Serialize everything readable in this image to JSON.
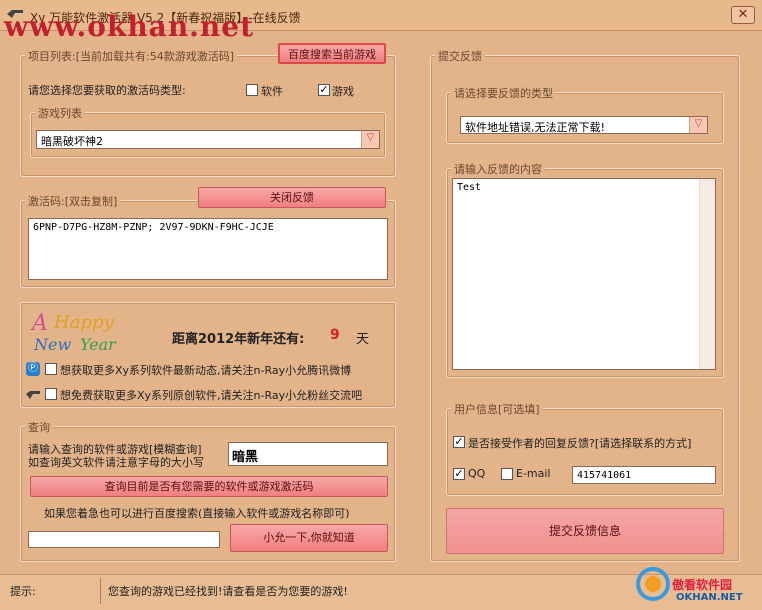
{
  "window": {
    "title": "Xy 万能软件激活器 V5.2【新春祝福版】-在线反馈",
    "watermark": "www.okhan.net",
    "close_label": "✕"
  },
  "project_list": {
    "legend": "项目列表:[当前加载共有:54款游戏激活码]",
    "baidu_search_button": "百度搜索当前游戏",
    "type_prompt": "请您选择您要获取的激活码类型:",
    "software_label": "软件",
    "software_checked": false,
    "game_label": "游戏",
    "game_checked": true,
    "game_list_legend": "游戏列表",
    "selected_game": "暗黑破坏神2"
  },
  "activation": {
    "legend": "激活码:[双击复制]",
    "close_feedback_button": "关闭反馈",
    "code_text": "6PNP-D7PG-HZ8M-PZNP; 2V97-9DKN-F9HC-JCJE"
  },
  "promo": {
    "logo_text": "AHappy New Year",
    "countdown_label": "距离2012年新年还有:",
    "countdown_days": "9",
    "countdown_unit": "天",
    "row1_text": "想获取更多Xy系列软件最新动态,请关注n-Ray小允腾讯微博",
    "row2_text": "想免费获取更多Xy系列原创软件,请关注n-Ray小允粉丝交流吧"
  },
  "query": {
    "legend": "查询",
    "prompt_line1": "请输入查询的软件或游戏[模糊查询]",
    "prompt_line2": "如查询英文软件请注意字母的大小写",
    "query_value": "暗黑",
    "check_button": "查询目前是否有您需要的软件或游戏激活码",
    "baidu_hint": "如果您着急也可以进行百度搜索(直接输入软件或游戏名称即可)",
    "baidu_input_value": "",
    "baidu_button": "小允一下,你就知道"
  },
  "feedback": {
    "legend": "提交反馈",
    "type_legend": "请选择要反馈的类型",
    "selected_type": "软件地址错误,无法正常下载!",
    "content_legend": "请输入反馈的内容",
    "content_value": "Test",
    "user_info_legend": "用户信息[可选填]",
    "accept_reply_label": "是否接受作者的回复反馈?[请选择联系的方式]",
    "accept_reply_checked": true,
    "qq_label": "QQ",
    "qq_checked": true,
    "email_label": "E-mail",
    "email_checked": false,
    "contact_value": "415741061",
    "submit_button": "提交反馈信息"
  },
  "status": {
    "label": "提示:",
    "message": "您查询的游戏已经找到!请查看是否为您要的游戏!",
    "brand_text": "傲看软件园",
    "brand_url": "OKHAN.NET"
  }
}
